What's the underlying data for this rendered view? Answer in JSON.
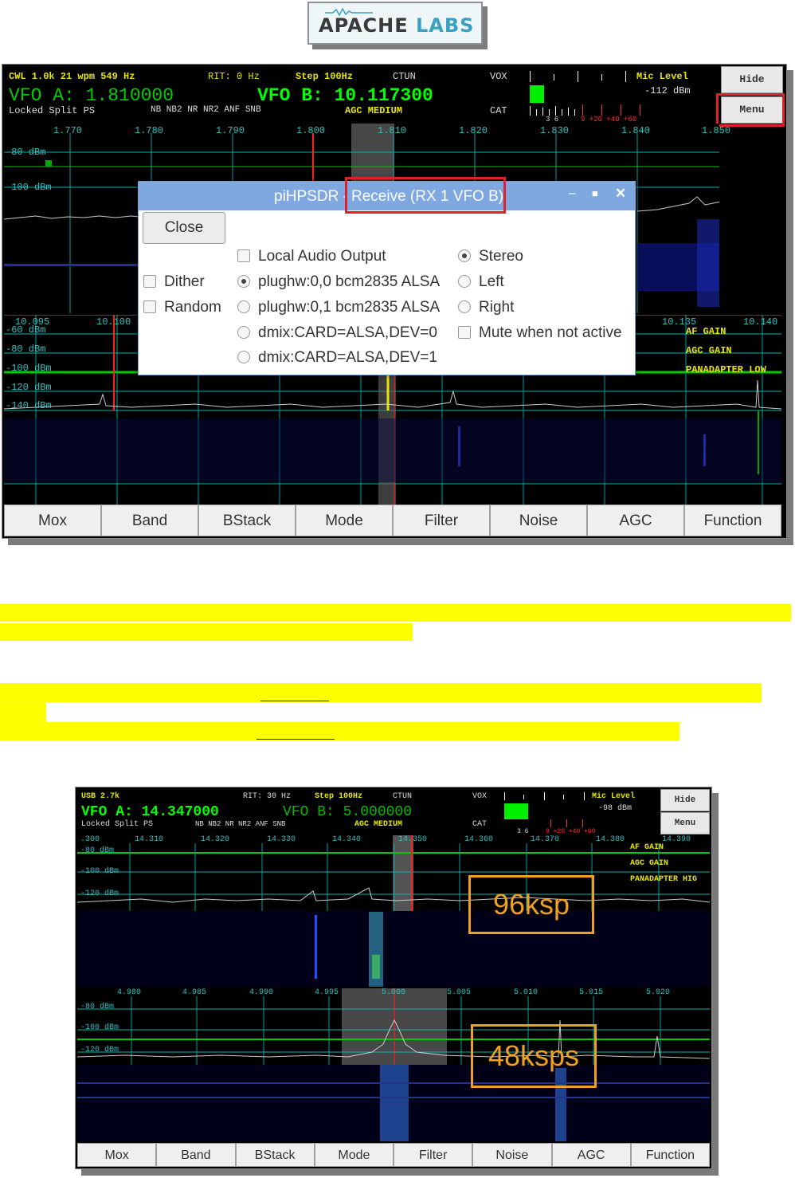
{
  "logo": {
    "brand_a": "APACHE",
    "brand_b": "LABS"
  },
  "screen1": {
    "hdr": {
      "mode": "CWL 1.0k 21 wpm 549 Hz",
      "rit": "RIT: 0 Hz",
      "step": "Step 100Hz",
      "ctun": "CTUN",
      "vox": "VOX",
      "mic_level": "Mic Level",
      "mic_dbm": "-112 dBm",
      "vfo_a": "VFO A: 1.810000",
      "vfo_b": "VFO B: 10.117300",
      "status_left": "Locked Split  PS",
      "status_mid": "NB  NB2 NR  NR2 ANF SNB",
      "agc": "AGC MEDIUM",
      "cat": "CAT",
      "meter_scale": "3   6",
      "meter_red": "9  +20  +40  +60"
    },
    "side": {
      "hide": "Hide",
      "menu": "Menu"
    },
    "pan1_freqs": [
      "1.770",
      "1.780",
      "1.790",
      "1.800",
      "1.810",
      "1.820",
      "1.830",
      "1.840",
      "1.850"
    ],
    "pan1_dbm": [
      "-80 dBm",
      "-100 dBm"
    ],
    "pan2_freqs_left": [
      "10.095",
      "10.100"
    ],
    "pan2_freqs_right": [
      "10.135",
      "10.140"
    ],
    "pan2_dbm": [
      "-60 dBm",
      "-80 dBm",
      "-100 dBm",
      "-120 dBm",
      "-140 dBm"
    ],
    "pan2_labels": [
      "AF GAIN",
      "AGC GAIN",
      "PANADAPTER LOW"
    ],
    "buttons": [
      "Mox",
      "Band",
      "BStack",
      "Mode",
      "Filter",
      "Noise",
      "AGC",
      "Function"
    ]
  },
  "dialog": {
    "title_prefix": "piHPSDR - ",
    "title_highlight": "Receive (RX 1 VFO B)",
    "close": "Close",
    "dither": "Dither",
    "random": "Random",
    "local_audio": "Local Audio Output",
    "devices": [
      "plughw:0,0 bcm2835 ALSA",
      "plughw:0,1 bcm2835 ALSA",
      "dmix:CARD=ALSA,DEV=0",
      "dmix:CARD=ALSA,DEV=1"
    ],
    "stereo": "Stereo",
    "left": "Left",
    "right": "Right",
    "mute": "Mute when not active"
  },
  "screen2": {
    "hdr": {
      "mode": "USB 2.7k",
      "rit": "RIT: 30 Hz",
      "step": "Step 100Hz",
      "ctun": "CTUN",
      "vox": "VOX",
      "mic_level": "Mic Level",
      "mic_dbm": "-98 dBm",
      "vfo_a": "VFO A: 14.347000",
      "vfo_b": "VFO B: 5.000000",
      "status_left": "Locked Split  PS",
      "status_mid": "NB  NB2 NR  NR2 ANF SNB",
      "agc": "AGC MEDIUM",
      "cat": "CAT",
      "meter_scale": "3   6",
      "meter_red": "9  +20  +40  +60"
    },
    "side": {
      "hide": "Hide",
      "menu": "Menu"
    },
    "pan1_freqs": [
      ".300",
      "14.310",
      "14.320",
      "14.330",
      "14.340",
      "14.350",
      "14.360",
      "14.370",
      "14.380",
      "14.390"
    ],
    "pan1_dbm": [
      "-80 dBm",
      "-100 dBm",
      "-120 dBm"
    ],
    "pan1_labels": [
      "AF GAIN",
      "AGC GAIN",
      "PANADAPTER HIG"
    ],
    "pan2_freqs": [
      "4.980",
      "4.985",
      "4.990",
      "4.995",
      "5.000",
      "5.005",
      "5.010",
      "5.015",
      "5.020"
    ],
    "pan2_dbm": [
      "-80 dBm",
      "-100 dBm",
      "-120 dBm"
    ],
    "rate1": "96ksp",
    "rate2": "48ksps",
    "buttons": [
      "Mox",
      "Band",
      "BStack",
      "Mode",
      "Filter",
      "Noise",
      "AGC",
      "Function"
    ]
  }
}
